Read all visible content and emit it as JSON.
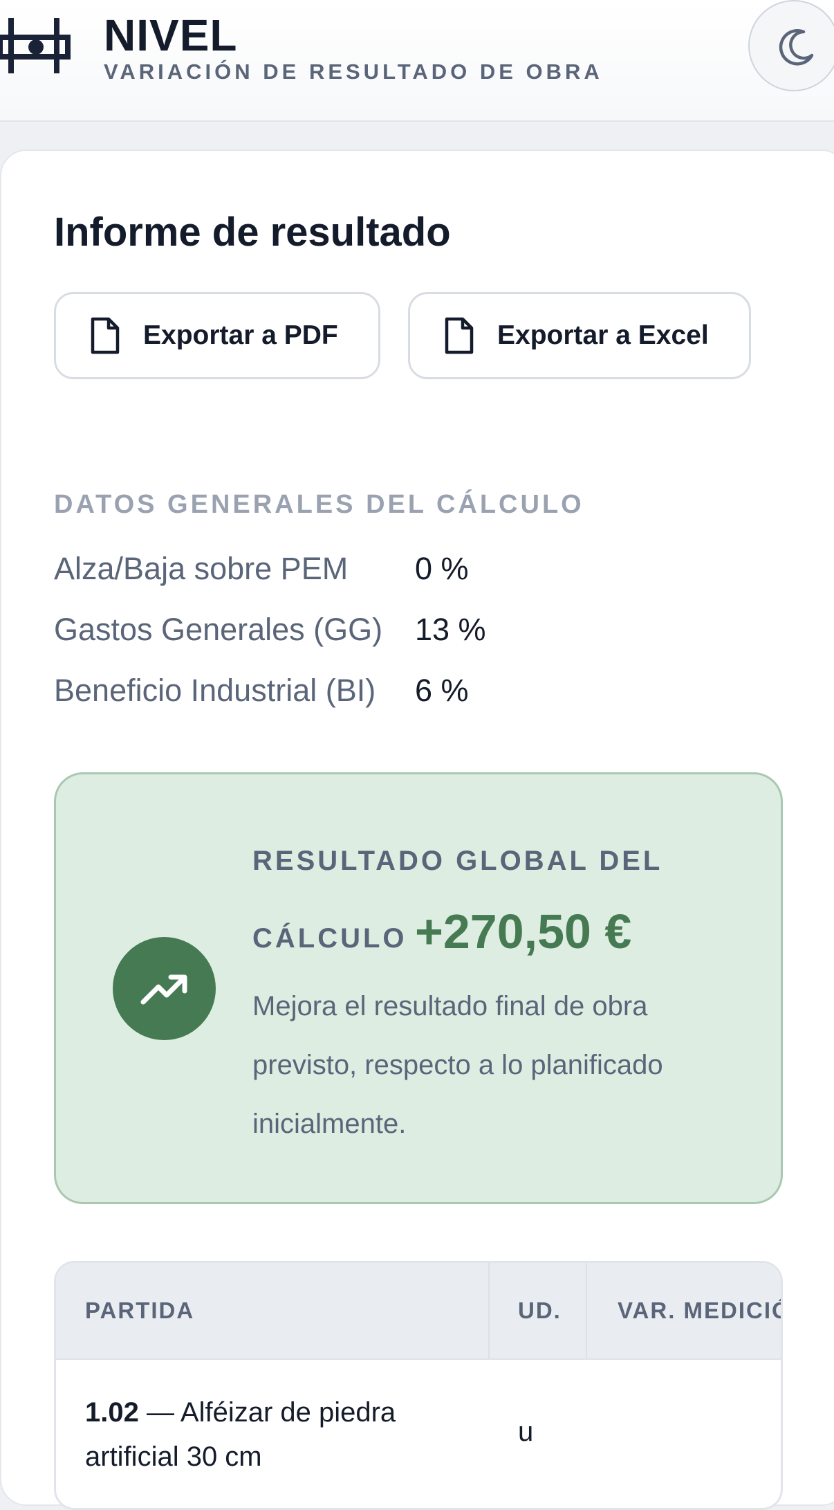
{
  "header": {
    "brand": "NIVEL",
    "subtitle": "VARIACIÓN DE RESULTADO DE OBRA",
    "theme_toggle_icon": "moon-icon",
    "logo_icon": "level-logo-icon"
  },
  "report": {
    "title": "Informe de resultado",
    "export_pdf_label": "Exportar a PDF",
    "export_excel_label": "Exportar a Excel",
    "export_icon": "document-icon"
  },
  "general": {
    "heading": "DATOS GENERALES DEL CÁLCULO",
    "params": [
      {
        "label": "Alza/Baja sobre PEM",
        "value": "0 %"
      },
      {
        "label": "Gastos Generales (GG)",
        "value": "13 %"
      },
      {
        "label": "Beneficio Industrial (BI)",
        "value": "6 %"
      }
    ]
  },
  "result": {
    "label_line1": "RESULTADO GLOBAL DEL",
    "label_line2": "CÁLCULO",
    "value": "+270,50 €",
    "description": "Mejora el resultado final de obra previsto, respecto a lo planificado inicialmente.",
    "icon": "trending-up-icon",
    "colors": {
      "positive": "#467a52",
      "box_bg": "#deede2"
    }
  },
  "table": {
    "columns": [
      "PARTIDA",
      "UD.",
      "VAR. MEDICIÓ"
    ],
    "rows": [
      {
        "code": "1.02",
        "separator": " — ",
        "description": "Alféizar de piedra artificial 30 cm",
        "unit": "u"
      }
    ]
  }
}
